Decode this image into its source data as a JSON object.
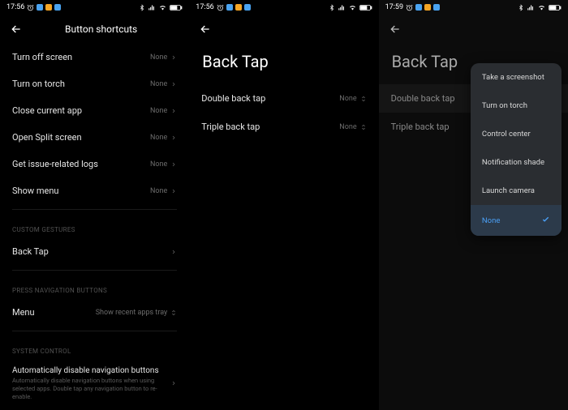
{
  "status": {
    "time1": "17:56",
    "time2": "17:56",
    "time3": "17:59"
  },
  "panel1": {
    "title": "Button shortcuts",
    "items": [
      {
        "label": "Turn off screen",
        "value": "None"
      },
      {
        "label": "Turn on torch",
        "value": "None"
      },
      {
        "label": "Close current app",
        "value": "None"
      },
      {
        "label": "Open Split screen",
        "value": "None"
      },
      {
        "label": "Get issue-related logs",
        "value": "None"
      },
      {
        "label": "Show menu",
        "value": "None"
      }
    ],
    "section1": "CUSTOM GESTURES",
    "backtap": "Back Tap",
    "section2": "PRESS NAVIGATION BUTTONS",
    "menu_label": "Menu",
    "menu_value": "Show recent apps tray",
    "section3": "SYSTEM CONTROL",
    "sys_title": "Automatically disable navigation buttons",
    "sys_sub": "Automatically disable navigation buttons when using selected apps. Double tap any navigation button to re-enable."
  },
  "panel2": {
    "title": "Back Tap",
    "items": [
      {
        "label": "Double back tap",
        "value": "None"
      },
      {
        "label": "Triple back tap",
        "value": "None"
      }
    ]
  },
  "panel3": {
    "title": "Back Tap",
    "items": [
      {
        "label": "Double back tap"
      },
      {
        "label": "Triple back tap"
      }
    ],
    "popup": [
      "Take a screenshot",
      "Turn on torch",
      "Control center",
      "Notification shade",
      "Launch camera",
      "None"
    ]
  }
}
